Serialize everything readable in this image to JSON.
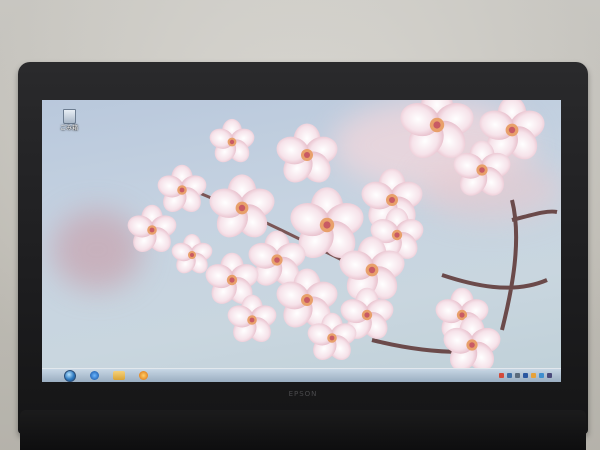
{
  "laptop": {
    "brand": "EPSON"
  },
  "desktop": {
    "icons": [
      {
        "label": "ごみ箱",
        "icon": "recycle-bin-icon"
      }
    ],
    "wallpaper": "cherry-blossom-wallpaper"
  },
  "taskbar": {
    "start_icon": "start-orb-icon",
    "pinned": [
      {
        "icon": "internet-explorer-icon"
      },
      {
        "icon": "folder-icon"
      },
      {
        "icon": "media-player-icon"
      }
    ],
    "tray": {
      "time": "",
      "date": ""
    }
  },
  "colors": {
    "sky": "#c6d3e1",
    "blossom": "#f4dbe3",
    "blossom_center": "#d97a8a",
    "branch": "#6b4a4a",
    "bezel": "#1d1d1f"
  }
}
